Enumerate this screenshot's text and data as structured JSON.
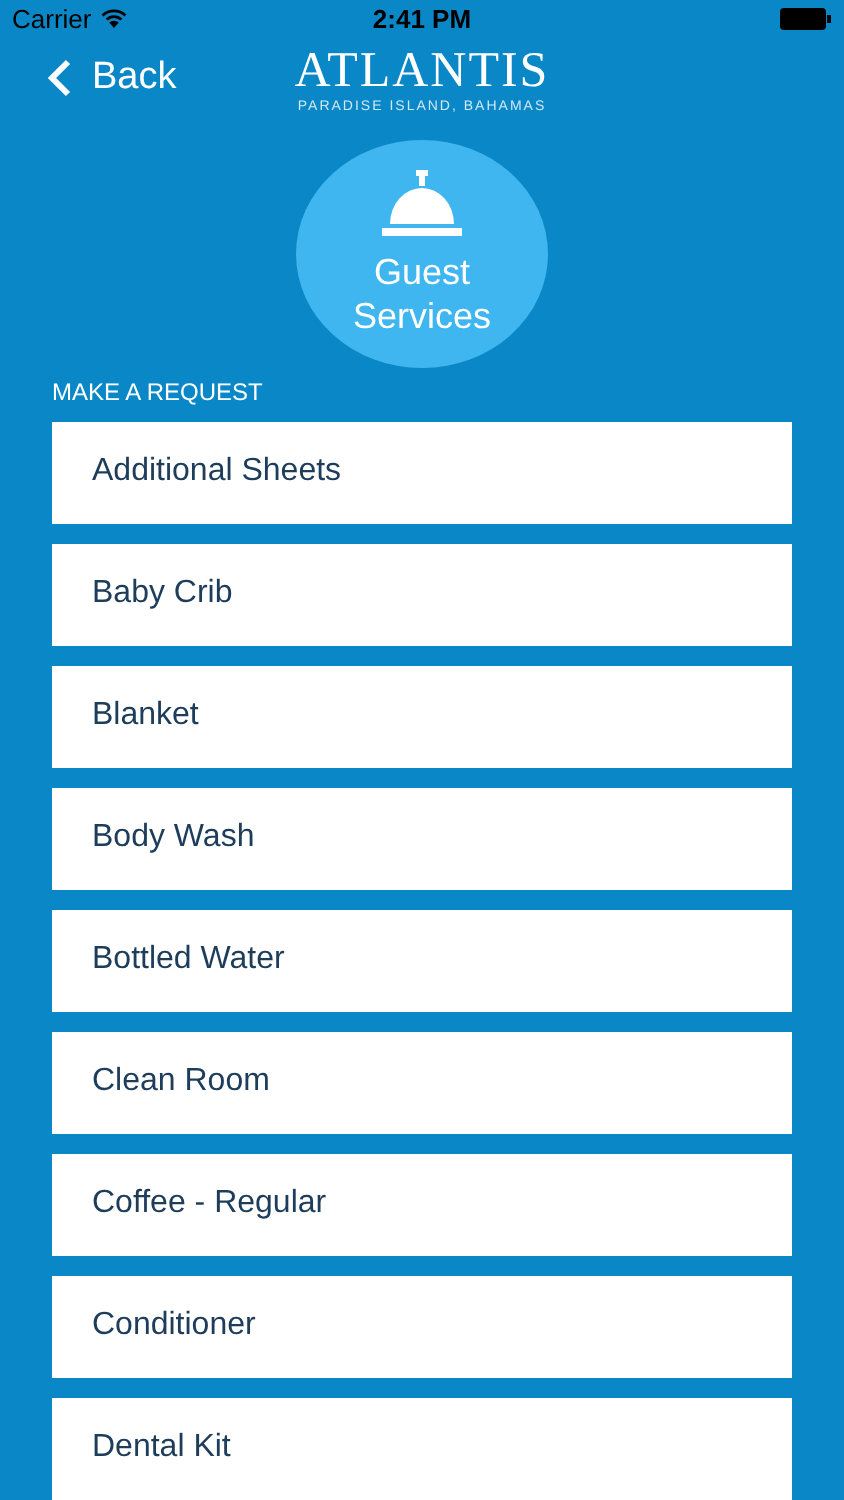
{
  "status_bar": {
    "carrier": "Carrier",
    "time": "2:41 PM"
  },
  "nav": {
    "back": "Back",
    "logo": "ATLANTIS",
    "logo_subtitle": "PARADISE ISLAND, BAHAMAS"
  },
  "header": {
    "title": "Guest Services"
  },
  "section_label": "MAKE A REQUEST",
  "requests": [
    "Additional Sheets",
    "Baby Crib",
    "Blanket",
    "Body Wash",
    "Bottled Water",
    "Clean Room",
    "Coffee - Regular",
    "Conditioner",
    "Dental Kit"
  ]
}
